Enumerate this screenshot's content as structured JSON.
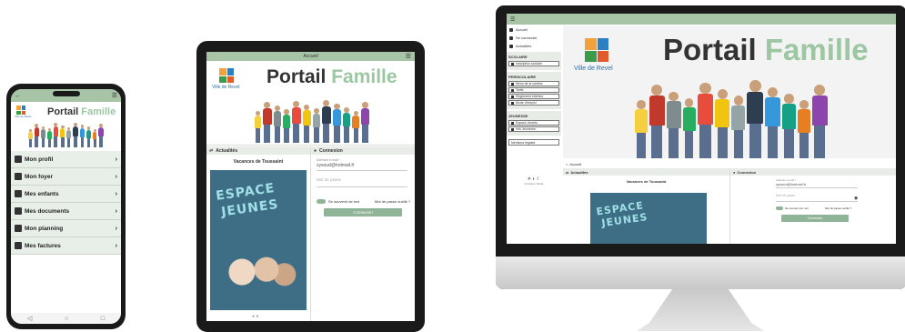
{
  "brand": {
    "word1": "Portail",
    "word2": "Famille",
    "city": "Ville de Revel"
  },
  "phone": {
    "menu": [
      "Mon profil",
      "Mon foyer",
      "Mes enfants",
      "Mes documents",
      "Mon planning",
      "Mes factures"
    ],
    "nav_icons": [
      "back-icon",
      "home-icon",
      "recents-icon"
    ]
  },
  "tablet": {
    "top_title": "Accueil",
    "news_title": "Actualités",
    "news_item_title": "Vacances de Toussaint",
    "poster_line1": "ESPACE",
    "poster_line2": "JEUNES",
    "login_title": "Connexion",
    "email_label": "Adresse e-mail *",
    "email_value": "sysoud@hotmail.fr",
    "password_placeholder": "Mot de passe",
    "remember_label": "Se souvenir de moi",
    "forgot_label": "Mot de passe oublié ?",
    "login_button": "Connexion"
  },
  "monitor": {
    "sidebar": {
      "items": [
        "Accueil",
        "Se connecter",
        "Actualités"
      ],
      "groups": [
        {
          "title": "SCOLAIRE",
          "items": [
            "Inscription scolaire"
          ]
        },
        {
          "title": "PERISCOLAIRE",
          "items": [
            "Menu de la cantine",
            "Tarifs",
            "Règlement intérieur",
            "Mode d'emploi"
          ]
        },
        {
          "title": "JEUNESSE",
          "items": [
            "Espace Jeunes",
            "Info Jeunesse"
          ]
        }
      ],
      "legal": "Mentions légales",
      "display_label": "Contrast / Mode"
    },
    "breadcrumb": "Accueil",
    "news_title": "Actualités",
    "news_item_title": "Vacances de Toussaint",
    "poster_line1": "ESPACE",
    "poster_line2": "JEUNES",
    "login_title": "Connexion",
    "email_label": "Adresse e-mail *",
    "email_value": "sysoud@hotmail.fr",
    "password_placeholder": "Mot de passe",
    "remember_label": "Se souvenir de moi",
    "forgot_label": "Mot de passe oublié ?",
    "login_button": "Connexion"
  },
  "colors": {
    "accent": "#a7c4a7",
    "button": "#8fb497",
    "brand_second": "#9cc7a2"
  }
}
